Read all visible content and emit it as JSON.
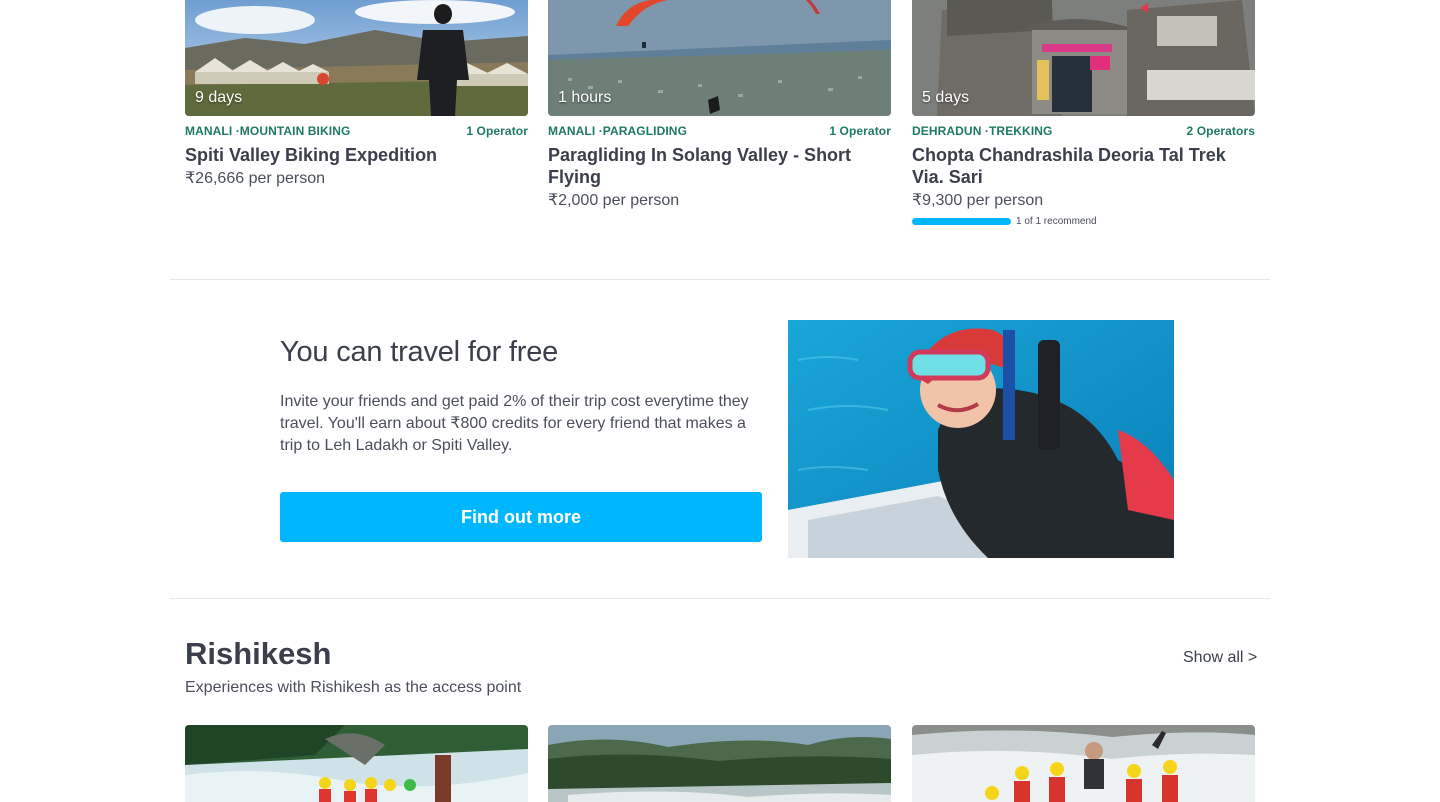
{
  "top_cards": [
    {
      "duration": "9 days",
      "location": "MANALI ·MOUNTAIN BIKING",
      "operators": "1 Operator",
      "title": "Spiti Valley Biking Expedition",
      "price": "₹26,666 per person",
      "image_icon": "biker-campsite-photo"
    },
    {
      "duration": "1 hours",
      "location": "MANALI ·PARAGLIDING",
      "operators": "1 Operator",
      "title": "Paragliding In Solang Valley - Short Flying",
      "price": "₹2,000 per person",
      "image_icon": "paragliding-valley-photo"
    },
    {
      "duration": "5 days",
      "location": "DEHRADUN ·TREKKING",
      "operators": "2 Operators",
      "title": "Chopta Chandrashila Deoria Tal Trek Via. Sari",
      "price": "₹9,300 per person",
      "recommend": "1 of 1 recommend",
      "recommend_fraction": 1.0,
      "image_icon": "temple-trek-photo"
    }
  ],
  "promo": {
    "title": "You can travel for free",
    "body": "Invite your friends and get paid 2% of their trip cost everytime they travel. You'll earn about ₹800 credits for every friend that makes a trip to Leh Ladakh or Spiti Valley.",
    "button": "Find out more",
    "image_icon": "scuba-diver-photo"
  },
  "section": {
    "title": "Rishikesh",
    "subtitle": "Experiences with Rishikesh as the access point",
    "show_all": "Show all >"
  },
  "bottom_cards": [
    {
      "image_icon": "river-rafting-photo"
    },
    {
      "image_icon": "forest-river-photo"
    },
    {
      "image_icon": "whitewater-rafting-photo"
    }
  ],
  "colors": {
    "accent": "#00b6ff",
    "category_green": "#1f7a62",
    "text": "#3a3f4b"
  }
}
